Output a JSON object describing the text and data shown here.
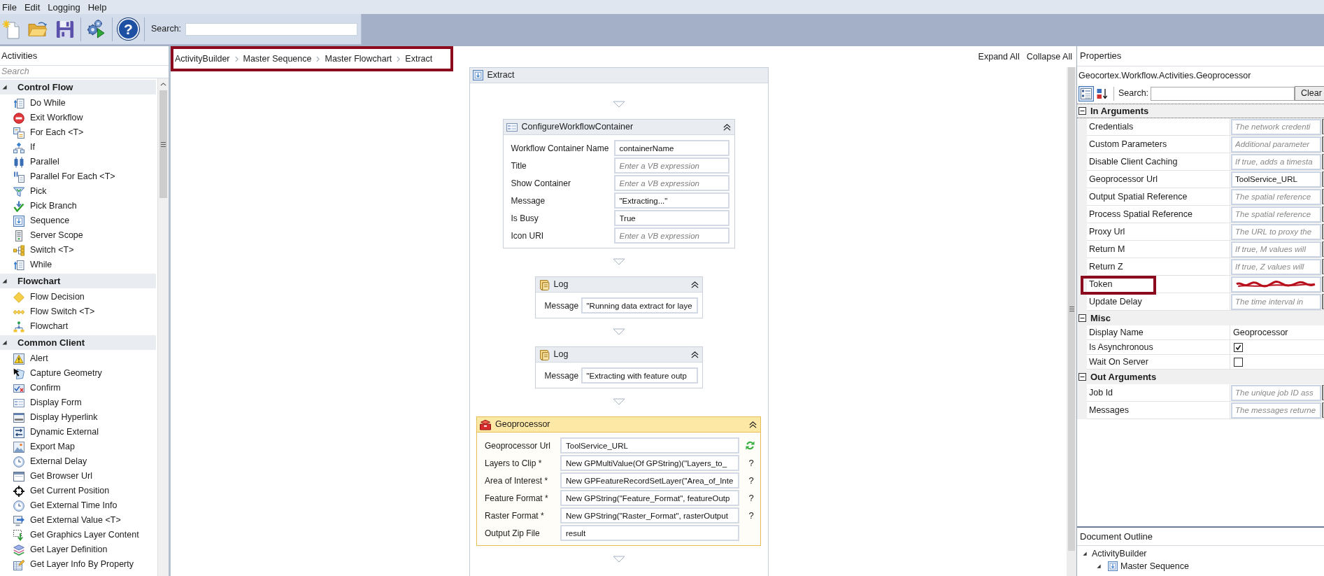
{
  "menu_bar": {
    "items": [
      "File",
      "Edit",
      "Logging",
      "Help"
    ]
  },
  "toolbar": {
    "help_button": "?",
    "search": {
      "label": "Search:"
    }
  },
  "activities_panel": {
    "title": "Activities",
    "search": {
      "placeholder": "Search"
    },
    "groups": [
      {
        "label": "Control Flow",
        "expanded": true,
        "items": [
          "Do While",
          "Exit Workflow",
          "For Each <T>",
          "If",
          "Parallel",
          "Parallel For Each <T>",
          "Pick",
          "Pick Branch",
          "Sequence",
          "Server Scope",
          "Switch <T>",
          "While"
        ]
      },
      {
        "label": "Flowchart",
        "expanded": true,
        "items": [
          "Flow Decision",
          "Flow Switch <T>",
          "Flowchart"
        ]
      },
      {
        "label": "Common Client",
        "expanded": true,
        "items": [
          "Alert",
          "Capture Geometry",
          "Confirm",
          "Display Form",
          "Display Hyperlink",
          "Dynamic External",
          "Export Map",
          "External Delay",
          "Get Browser Url",
          "Get Current Position",
          "Get External Time Info",
          "Get External Value <T>",
          "Get Graphics Layer Content",
          "Get Layer Definition",
          "Get Layer Info By Property"
        ]
      }
    ]
  },
  "designer": {
    "breadcrumb": {
      "highlighted": true,
      "items": [
        "ActivityBuilder",
        "Master Sequence",
        "Master Flowchart",
        "Extract"
      ]
    },
    "actions": [
      "Expand All",
      "Collapse All"
    ],
    "sequence": {
      "title": "Extract",
      "activities": [
        {
          "kind": "form",
          "title": "ConfigureWorkflowContainer",
          "selected": false,
          "fields": [
            {
              "label": "Workflow Container Name",
              "value": "containerName"
            },
            {
              "label": "Title",
              "placeholder": "Enter a VB expression"
            },
            {
              "label": "Show Container",
              "placeholder": "Enter a VB expression"
            },
            {
              "label": "Message",
              "value": "\"Extracting...\""
            },
            {
              "label": "Is Busy",
              "value": "True"
            },
            {
              "label": "Icon URI",
              "placeholder": "Enter a VB expression"
            }
          ]
        },
        {
          "kind": "log",
          "title": "Log",
          "selected": false,
          "fields": [
            {
              "label": "Message",
              "value": "\"Running data extract for laye"
            }
          ]
        },
        {
          "kind": "log",
          "title": "Log",
          "selected": false,
          "fields": [
            {
              "label": "Message",
              "value": "\"Extracting with feature outp"
            }
          ]
        },
        {
          "kind": "geoprocessor",
          "title": "Geoprocessor",
          "selected": true,
          "fields": [
            {
              "kind": "refresh",
              "label": "Geoprocessor Url",
              "value": "ToolService_URL"
            },
            {
              "kind": "hint",
              "label": "Layers to Clip *",
              "value": "New GPMultiValue(Of GPString)(\"Layers_to_",
              "note": "?"
            },
            {
              "kind": "hint",
              "label": "Area of Interest *",
              "value": "New GPFeatureRecordSetLayer(\"Area_of_Inte",
              "note": "?"
            },
            {
              "kind": "hint",
              "label": "Feature Format *",
              "value": "New GPString(\"Feature_Format\", featureOutp",
              "note": "?"
            },
            {
              "kind": "hint",
              "label": "Raster Format *",
              "value": "New GPString(\"Raster_Format\", rasterOutput",
              "note": "?"
            },
            {
              "kind": "plain",
              "label": "Output Zip File",
              "value": "result"
            }
          ]
        }
      ]
    }
  },
  "properties_panel": {
    "title": "Properties",
    "object_type": "Geocortex.Workflow.Activities.Geoprocessor",
    "view_modes": [
      {
        "kind": "categorized",
        "selected": true
      },
      {
        "kind": "alphabetical",
        "selected": false
      }
    ],
    "search": {
      "label": "Search:"
    },
    "clear_button": "Clear",
    "categories": [
      {
        "label": "In Arguments",
        "expanded": true,
        "focused": true,
        "rows": [
          {
            "kind": "expression",
            "name": "Credentials",
            "placeholder": "The network credenti",
            "highlighted": false
          },
          {
            "kind": "expression",
            "name": "Custom Parameters",
            "placeholder": "Additional parameter",
            "highlighted": false
          },
          {
            "kind": "expression",
            "name": "Disable Client Caching",
            "placeholder": "If true, adds a timesta",
            "highlighted": false
          },
          {
            "kind": "expression",
            "name": "Geoprocessor Url",
            "value": "ToolService_URL",
            "highlighted": false
          },
          {
            "kind": "expression",
            "name": "Output Spatial Reference",
            "placeholder": "The spatial reference",
            "highlighted": false
          },
          {
            "kind": "expression",
            "name": "Process Spatial Reference",
            "placeholder": "The spatial reference",
            "highlighted": false
          },
          {
            "kind": "expression",
            "name": "Proxy Url",
            "placeholder": "The URL to proxy the",
            "highlighted": false
          },
          {
            "kind": "expression",
            "name": "Return M",
            "placeholder": "If true, M values will",
            "highlighted": false
          },
          {
            "kind": "expression",
            "name": "Return Z",
            "placeholder": "If true, Z values will",
            "highlighted": false
          },
          {
            "kind": "redacted",
            "name": "Token",
            "highlighted": true
          },
          {
            "kind": "expression",
            "name": "Update Delay",
            "placeholder": "The time interval in",
            "highlighted": false
          }
        ]
      },
      {
        "label": "Misc",
        "expanded": true,
        "focused": false,
        "rows": [
          {
            "kind": "text",
            "name": "Display Name",
            "value": "Geoprocessor",
            "highlighted": false
          },
          {
            "kind": "checkbox",
            "name": "Is Asynchronous",
            "checked": true,
            "highlighted": false
          },
          {
            "kind": "checkbox",
            "name": "Wait On Server",
            "checked": false,
            "highlighted": false
          }
        ]
      },
      {
        "label": "Out Arguments",
        "expanded": true,
        "focused": false,
        "rows": [
          {
            "kind": "expression",
            "name": "Job Id",
            "placeholder": "The unique job ID ass",
            "highlighted": false
          },
          {
            "kind": "expression",
            "name": "Messages",
            "placeholder": "The messages returne",
            "highlighted": false
          }
        ]
      }
    ]
  },
  "document_outline": {
    "title": "Document Outline",
    "tree": [
      {
        "label": "ActivityBuilder",
        "expanded": true,
        "children": [
          {
            "kind": "sequence",
            "label": "Master Sequence",
            "expanded": true
          }
        ]
      }
    ]
  }
}
